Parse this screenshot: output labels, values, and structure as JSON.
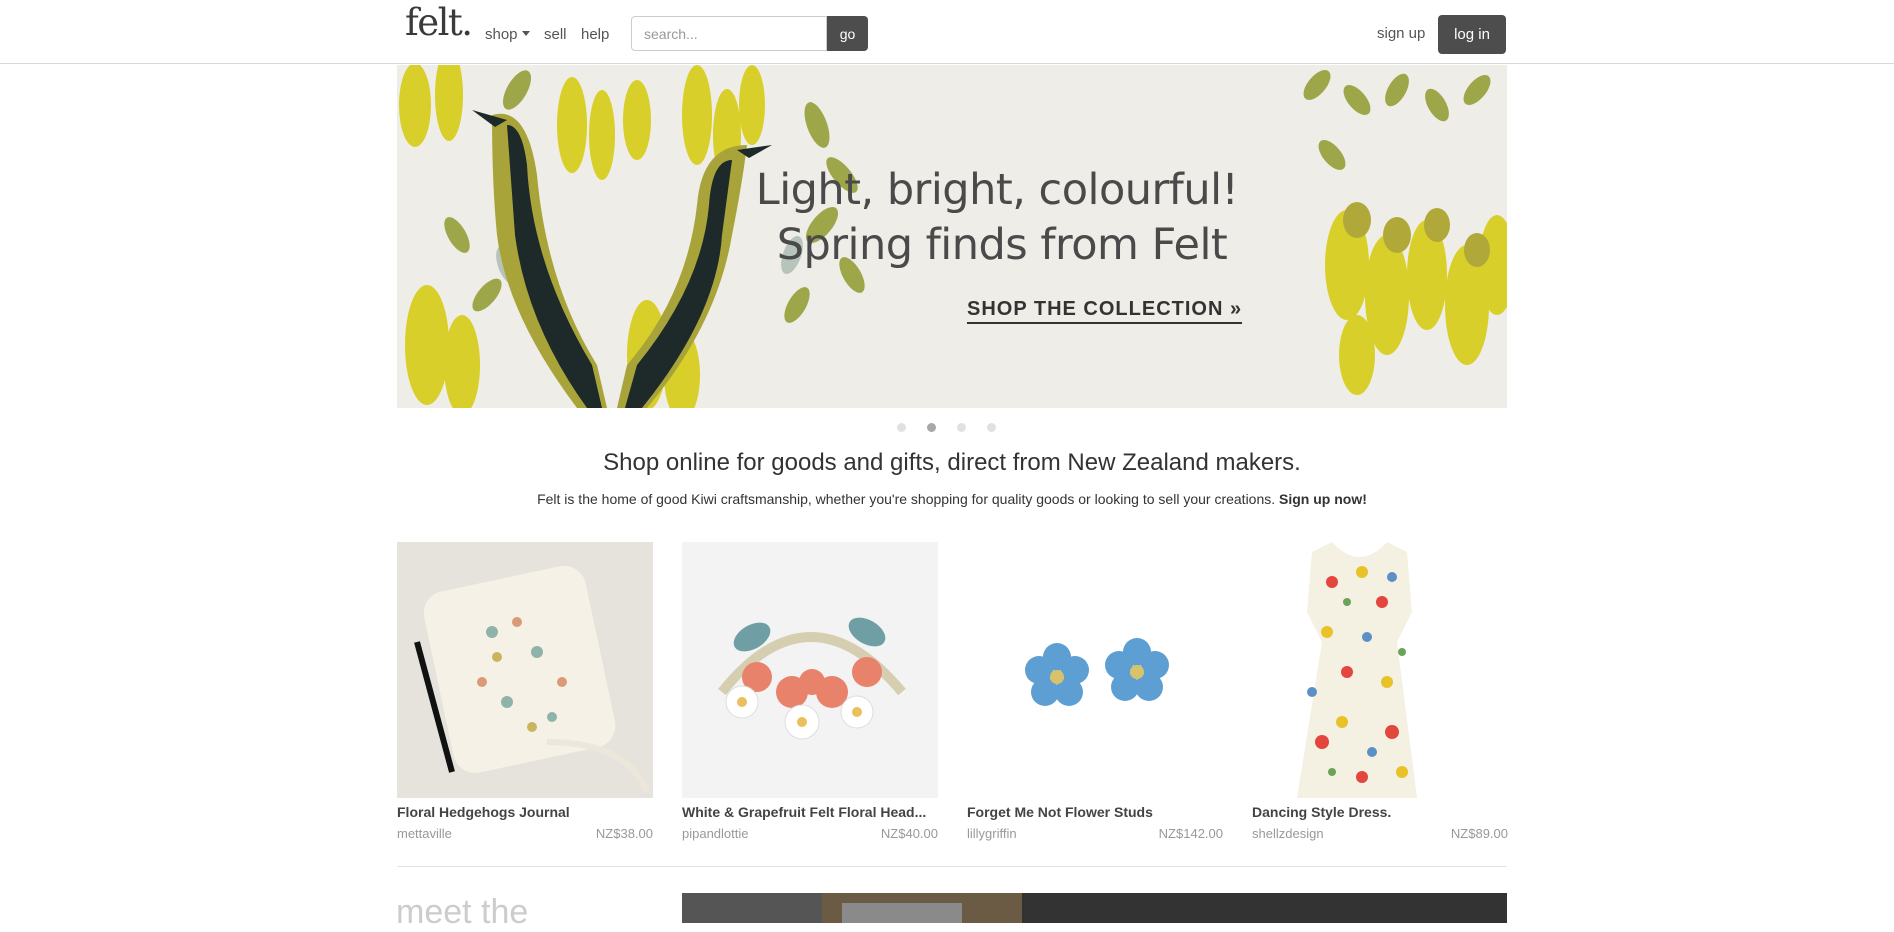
{
  "header": {
    "logo": "felt.",
    "nav": {
      "shop": "shop",
      "sell": "sell",
      "help": "help"
    },
    "search": {
      "placeholder": "search...",
      "button": "go"
    },
    "sign_up": "sign up",
    "log_in": "log in"
  },
  "banner": {
    "line1": "Light, bright, colourful!",
    "line2": "Spring finds from Felt",
    "cta": "SHOP THE COLLECTION »"
  },
  "carousel": {
    "slide_count": 4,
    "active_index": 1
  },
  "intro": {
    "headline": "Shop online for goods and gifts, direct from New Zealand makers.",
    "body": "Felt is the home of good Kiwi craftsmanship, whether you're shopping for quality goods or looking to sell your creations.",
    "signup_link": "Sign up now!"
  },
  "products": [
    {
      "title": "Floral Hedgehogs Journal",
      "seller": "mettaville",
      "price": "NZ$38.00"
    },
    {
      "title": "White & Grapefruit Felt Floral Head...",
      "seller": "pipandlottie",
      "price": "NZ$40.00"
    },
    {
      "title": "Forget Me Not Flower Studs",
      "seller": "lillygriffin",
      "price": "NZ$142.00"
    },
    {
      "title": "Dancing Style Dress.",
      "seller": "shellzdesign",
      "price": "NZ$89.00"
    }
  ],
  "makers": {
    "heading": "meet the"
  }
}
